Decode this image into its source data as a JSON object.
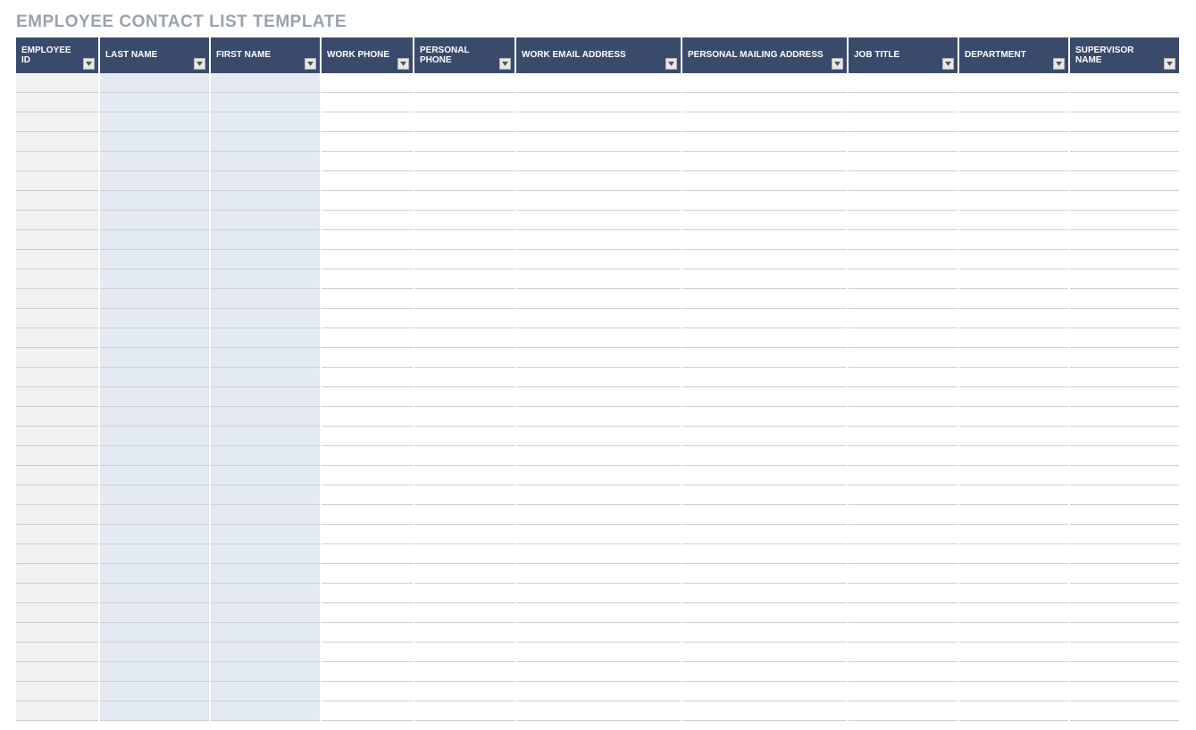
{
  "title": "EMPLOYEE CONTACT LIST TEMPLATE",
  "columns": [
    "EMPLOYEE ID",
    "LAST NAME",
    "FIRST NAME",
    "WORK PHONE",
    "PERSONAL PHONE",
    "WORK EMAIL ADDRESS",
    "PERSONAL MAILING ADDRESS",
    "JOB TITLE",
    "DEPARTMENT",
    "SUPERVISOR NAME"
  ],
  "rows": [
    [
      "",
      "",
      "",
      "",
      "",
      "",
      "",
      "",
      "",
      ""
    ],
    [
      "",
      "",
      "",
      "",
      "",
      "",
      "",
      "",
      "",
      ""
    ],
    [
      "",
      "",
      "",
      "",
      "",
      "",
      "",
      "",
      "",
      ""
    ],
    [
      "",
      "",
      "",
      "",
      "",
      "",
      "",
      "",
      "",
      ""
    ],
    [
      "",
      "",
      "",
      "",
      "",
      "",
      "",
      "",
      "",
      ""
    ],
    [
      "",
      "",
      "",
      "",
      "",
      "",
      "",
      "",
      "",
      ""
    ],
    [
      "",
      "",
      "",
      "",
      "",
      "",
      "",
      "",
      "",
      ""
    ],
    [
      "",
      "",
      "",
      "",
      "",
      "",
      "",
      "",
      "",
      ""
    ],
    [
      "",
      "",
      "",
      "",
      "",
      "",
      "",
      "",
      "",
      ""
    ],
    [
      "",
      "",
      "",
      "",
      "",
      "",
      "",
      "",
      "",
      ""
    ],
    [
      "",
      "",
      "",
      "",
      "",
      "",
      "",
      "",
      "",
      ""
    ],
    [
      "",
      "",
      "",
      "",
      "",
      "",
      "",
      "",
      "",
      ""
    ],
    [
      "",
      "",
      "",
      "",
      "",
      "",
      "",
      "",
      "",
      ""
    ],
    [
      "",
      "",
      "",
      "",
      "",
      "",
      "",
      "",
      "",
      ""
    ],
    [
      "",
      "",
      "",
      "",
      "",
      "",
      "",
      "",
      "",
      ""
    ],
    [
      "",
      "",
      "",
      "",
      "",
      "",
      "",
      "",
      "",
      ""
    ],
    [
      "",
      "",
      "",
      "",
      "",
      "",
      "",
      "",
      "",
      ""
    ],
    [
      "",
      "",
      "",
      "",
      "",
      "",
      "",
      "",
      "",
      ""
    ],
    [
      "",
      "",
      "",
      "",
      "",
      "",
      "",
      "",
      "",
      ""
    ],
    [
      "",
      "",
      "",
      "",
      "",
      "",
      "",
      "",
      "",
      ""
    ],
    [
      "",
      "",
      "",
      "",
      "",
      "",
      "",
      "",
      "",
      ""
    ],
    [
      "",
      "",
      "",
      "",
      "",
      "",
      "",
      "",
      "",
      ""
    ],
    [
      "",
      "",
      "",
      "",
      "",
      "",
      "",
      "",
      "",
      ""
    ],
    [
      "",
      "",
      "",
      "",
      "",
      "",
      "",
      "",
      "",
      ""
    ],
    [
      "",
      "",
      "",
      "",
      "",
      "",
      "",
      "",
      "",
      ""
    ],
    [
      "",
      "",
      "",
      "",
      "",
      "",
      "",
      "",
      "",
      ""
    ],
    [
      "",
      "",
      "",
      "",
      "",
      "",
      "",
      "",
      "",
      ""
    ],
    [
      "",
      "",
      "",
      "",
      "",
      "",
      "",
      "",
      "",
      ""
    ],
    [
      "",
      "",
      "",
      "",
      "",
      "",
      "",
      "",
      "",
      ""
    ],
    [
      "",
      "",
      "",
      "",
      "",
      "",
      "",
      "",
      "",
      ""
    ],
    [
      "",
      "",
      "",
      "",
      "",
      "",
      "",
      "",
      "",
      ""
    ],
    [
      "",
      "",
      "",
      "",
      "",
      "",
      "",
      "",
      "",
      ""
    ],
    [
      "",
      "",
      "",
      "",
      "",
      "",
      "",
      "",
      "",
      ""
    ]
  ]
}
